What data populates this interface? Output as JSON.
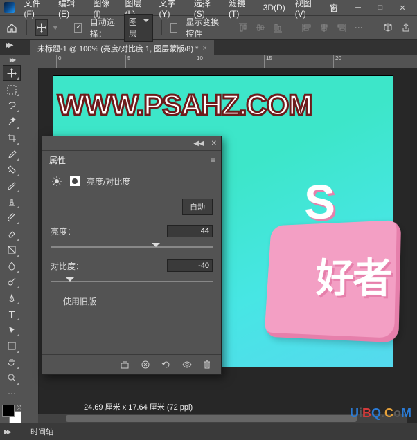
{
  "menu": {
    "items": [
      "文件(F)",
      "编辑(E)",
      "图像(I)",
      "图层(L)",
      "文字(Y)",
      "选择(S)",
      "滤镜(T)",
      "3D(D)",
      "视图(V)",
      "窗"
    ]
  },
  "options": {
    "auto_select": "自动选择：",
    "auto_select_target": "图层",
    "show_transform": "显示变换控件"
  },
  "doc": {
    "tab_title": "未标题-1 @ 100% (亮度/对比度 1, 图层蒙版/8) *",
    "watermark": "WWW.PSAHZ.COM",
    "text3d_a": "S",
    "text3d_b": "好者",
    "dims": "24.69 厘米 x 17.64 厘米 (72 ppi)"
  },
  "ruler": {
    "ticks": [
      "0",
      "5",
      "10",
      "15",
      "20"
    ]
  },
  "panel": {
    "title": "属性",
    "adj_name": "亮度/对比度",
    "auto_btn": "自动",
    "brightness_label": "亮度：",
    "brightness_value": "44",
    "contrast_label": "对比度：",
    "contrast_value": "-40",
    "legacy": "使用旧版"
  },
  "timeline": {
    "label": "时间轴"
  },
  "watermark2": {
    "a": "U",
    "b": "i",
    "c": "B",
    "d": "Q",
    "e": ".",
    "f": "C",
    "g": "o",
    "h": "M"
  }
}
